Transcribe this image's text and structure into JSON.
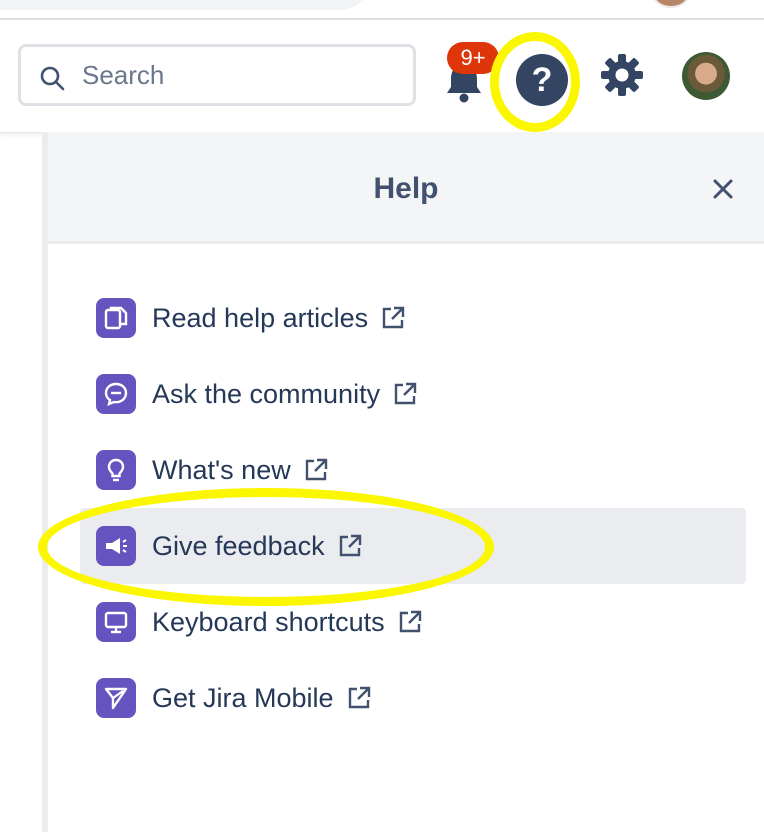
{
  "header": {
    "search": {
      "placeholder": "Search",
      "value": ""
    },
    "notifications_badge": "9+",
    "help_glyph": "?",
    "icons": [
      "search-icon",
      "bell-icon",
      "help-icon",
      "gear-icon",
      "avatar"
    ]
  },
  "help_panel": {
    "title": "Help",
    "close_glyph": "×",
    "items": [
      {
        "label": "Read help articles",
        "icon": "document-icon"
      },
      {
        "label": "Ask the community",
        "icon": "chat-icon"
      },
      {
        "label": "What's new",
        "icon": "lightbulb-icon"
      },
      {
        "label": "Give feedback",
        "icon": "megaphone-icon",
        "selected": true
      },
      {
        "label": "Keyboard shortcuts",
        "icon": "monitor-icon"
      },
      {
        "label": "Get Jira Mobile",
        "icon": "send-icon"
      }
    ]
  },
  "colors": {
    "item_icon_bg": "#6554c0",
    "badge": "#de350b",
    "highlight": "#fbf700",
    "text": "#253858"
  }
}
